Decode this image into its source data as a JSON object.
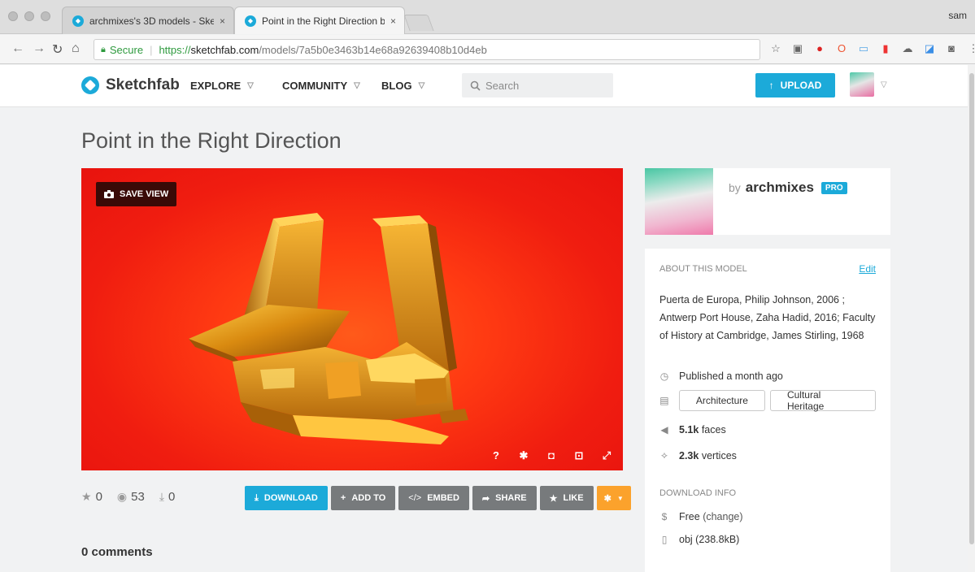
{
  "browser": {
    "tabs": [
      {
        "title": "archmixes's 3D models - Sketc",
        "active": false
      },
      {
        "title": "Point in the Right Direction by",
        "active": true
      }
    ],
    "user": "sam",
    "url": {
      "secure_label": "Secure",
      "scheme": "https://",
      "host": "sketchfab.com",
      "path": "/models/7a5b0e3463b14e68a92639408b10d4eb"
    }
  },
  "header": {
    "brand": "Sketchfab",
    "nav": [
      "EXPLORE",
      "COMMUNITY",
      "BLOG"
    ],
    "search_placeholder": "Search",
    "upload_label": "UPLOAD"
  },
  "model": {
    "title": "Point in the Right Direction",
    "save_view_label": "SAVE VIEW",
    "stats": {
      "likes": "0",
      "views": "53",
      "downloads": "0"
    },
    "actions": {
      "download": "DOWNLOAD",
      "add_to": "ADD TO",
      "embed": "EMBED",
      "share": "SHARE",
      "like": "LIKE"
    },
    "comments": "0 comments"
  },
  "author": {
    "by": "by",
    "name": "archmixes",
    "badge": "PRO"
  },
  "about": {
    "heading": "ABOUT THIS MODEL",
    "edit": "Edit",
    "description_lines": [
      "Puerta de Europa, Philip Johnson, 2006 ;",
      "Antwerp Port House, Zaha Hadid, 2016; Faculty",
      "of History at Cambridge, James Stirling, 1968"
    ],
    "published": "Published a month ago",
    "tags": [
      "Architecture",
      "Cultural Heritage"
    ],
    "faces_value": "5.1k",
    "faces_label": "faces",
    "vertices_value": "2.3k",
    "vertices_label": "vertices",
    "download_heading": "DOWNLOAD INFO",
    "price": "Free",
    "change": "(change)",
    "file": "obj (238.8kB)"
  },
  "colors": {
    "accent": "#1caad9",
    "viewer_bg": "#f01d10",
    "like_orange": "#fba22c"
  }
}
